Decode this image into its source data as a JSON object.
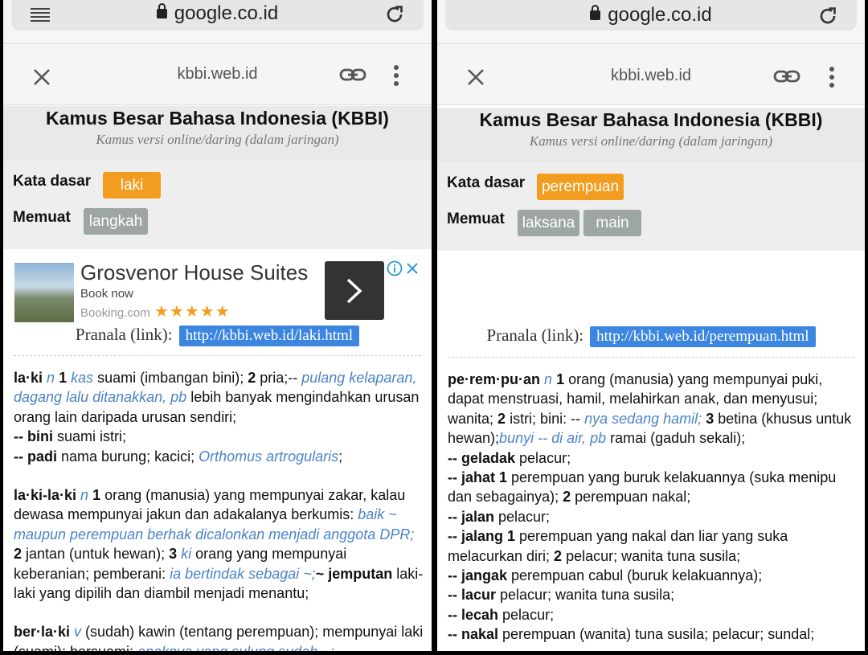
{
  "left": {
    "url": "google.co.id",
    "cct_url": "kbbi.web.id",
    "title": "Kamus Besar Bahasa Indonesia (KBBI)",
    "subtitle": "Kamus versi online/daring (dalam jaringan)",
    "kata_dasar_label": "Kata dasar",
    "kata_dasar_chips": [
      "laki"
    ],
    "memuat_label": "Memuat",
    "memuat_chips": [
      "langkah"
    ],
    "ad": {
      "title": "Grosvenor House Suites",
      "subtitle": "Book now",
      "source": "Booking.com",
      "rating": 5
    },
    "pranala_label": "Pranala (link):",
    "pranala_link": "http://kbbi.web.id/laki.html",
    "entries": [
      {
        "runs": [
          [
            "b",
            "la·ki"
          ],
          [
            "t",
            " "
          ],
          [
            "e",
            "n"
          ],
          [
            "t",
            " "
          ],
          [
            "b",
            "1"
          ],
          [
            "t",
            " "
          ],
          [
            "e",
            "kas"
          ],
          [
            "t",
            " suami (imbangan bini); "
          ],
          [
            "b",
            "2"
          ],
          [
            "t",
            " pria;-- "
          ],
          [
            "it",
            "pulang kelaparan, dagang lalu ditanakkan, pb"
          ],
          [
            "t",
            " lebih banyak mengindahkan urusan orang lain daripada urusan sendiri;"
          ],
          [
            "br",
            ""
          ],
          [
            "b",
            "-- bini"
          ],
          [
            "t",
            " suami istri;"
          ],
          [
            "br",
            ""
          ],
          [
            "b",
            "-- padi"
          ],
          [
            "t",
            " nama burung; kacici; "
          ],
          [
            "it",
            "Orthomus artrogularis"
          ],
          [
            "t",
            ";"
          ]
        ]
      },
      {
        "runs": [
          [
            "b",
            "la·ki-la·ki"
          ],
          [
            "t",
            " "
          ],
          [
            "e",
            "n"
          ],
          [
            "t",
            " "
          ],
          [
            "b",
            "1"
          ],
          [
            "t",
            " orang (manusia) yang mempunyai zakar, kalau dewasa mempunyai jakun dan adakalanya berkumis: "
          ],
          [
            "it",
            "baik ~ maupun perempuan berhak dicalonkan menjadi anggota DPR;"
          ],
          [
            "t",
            " "
          ],
          [
            "b",
            "2"
          ],
          [
            "t",
            " jantan (untuk hewan); "
          ],
          [
            "b",
            "3"
          ],
          [
            "t",
            " "
          ],
          [
            "e",
            "ki"
          ],
          [
            "t",
            " orang yang mempunyai keberanian; pemberani: "
          ],
          [
            "it",
            "ia bertindak sebagai ~;"
          ],
          [
            "b",
            "~ jemputan"
          ],
          [
            "t",
            " laki-laki yang dipilih dan diambil menjadi menantu;"
          ]
        ]
      },
      {
        "runs": [
          [
            "b",
            "ber·la·ki"
          ],
          [
            "t",
            " "
          ],
          [
            "e",
            "v"
          ],
          [
            "t",
            " (sudah) kawin (tentang perempuan); mempunyai laki (suami); bersuami: "
          ],
          [
            "it",
            "anaknya yang sulung sudah ~;"
          ]
        ]
      }
    ]
  },
  "right": {
    "url": "google.co.id",
    "cct_url": "kbbi.web.id",
    "title": "Kamus Besar Bahasa Indonesia (KBBI)",
    "subtitle": "Kamus versi online/daring (dalam jaringan)",
    "kata_dasar_label": "Kata dasar",
    "kata_dasar_chips": [
      "perempuan"
    ],
    "memuat_label": "Memuat",
    "memuat_chips": [
      "laksana",
      "main"
    ],
    "pranala_label": "Pranala (link):",
    "pranala_link": "http://kbbi.web.id/perempuan.html",
    "entries": [
      {
        "runs": [
          [
            "b",
            "pe·rem·pu·an"
          ],
          [
            "t",
            " "
          ],
          [
            "e",
            "n"
          ],
          [
            "t",
            " "
          ],
          [
            "b",
            "1"
          ],
          [
            "t",
            " orang (manusia) yang mempunyai puki, dapat menstruasi, hamil, melahirkan anak, dan menyusui; wanita; "
          ],
          [
            "b",
            "2"
          ],
          [
            "t",
            " istri; bini: -- "
          ],
          [
            "it",
            "nya sedang hamil;"
          ],
          [
            "t",
            " "
          ],
          [
            "b",
            "3"
          ],
          [
            "t",
            " betina (khusus untuk hewan);"
          ],
          [
            "it",
            "bunyi -- di air, pb"
          ],
          [
            "t",
            " ramai (gaduh sekali);"
          ],
          [
            "br",
            ""
          ],
          [
            "b",
            "-- geladak"
          ],
          [
            "t",
            " pelacur;"
          ],
          [
            "br",
            ""
          ],
          [
            "b",
            "-- jahat 1"
          ],
          [
            "t",
            " perempuan yang buruk kelakuannya (suka menipu dan sebagainya); "
          ],
          [
            "b",
            "2"
          ],
          [
            "t",
            " perempuan nakal;"
          ],
          [
            "br",
            ""
          ],
          [
            "b",
            "-- jalan"
          ],
          [
            "t",
            " pelacur;"
          ],
          [
            "br",
            ""
          ],
          [
            "b",
            "-- jalang 1"
          ],
          [
            "t",
            " perempuan yang nakal dan liar yang suka melacurkan diri; "
          ],
          [
            "b",
            "2"
          ],
          [
            "t",
            " pelacur; wanita tuna susila;"
          ],
          [
            "br",
            ""
          ],
          [
            "b",
            "-- jangak"
          ],
          [
            "t",
            " perempuan cabul (buruk kelakuannya);"
          ],
          [
            "br",
            ""
          ],
          [
            "b",
            "-- lacur"
          ],
          [
            "t",
            " pelacur; wanita tuna susila;"
          ],
          [
            "br",
            ""
          ],
          [
            "b",
            "-- lecah"
          ],
          [
            "t",
            " pelacur;"
          ],
          [
            "br",
            ""
          ],
          [
            "b",
            "-- nakal"
          ],
          [
            "t",
            " perempuan (wanita) tuna susila; pelacur; sundal;"
          ]
        ]
      }
    ]
  }
}
